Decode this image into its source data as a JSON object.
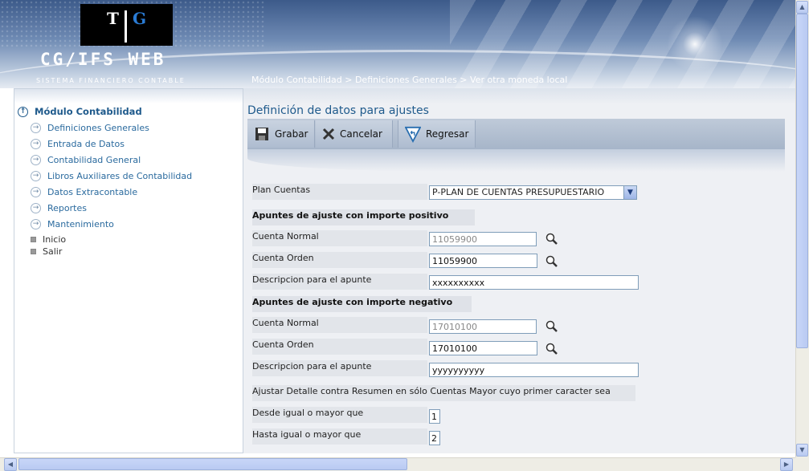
{
  "header": {
    "logo_left": "T",
    "logo_right": "G",
    "app_title": "CG/IFS WEB",
    "app_subtitle": "SISTEMA FINANCIERO CONTABLE",
    "breadcrumb": "Módulo Contabilidad > Definiciones Generales > Ver otra moneda local"
  },
  "sidebar": {
    "module": "Módulo Contabilidad",
    "items": [
      {
        "label": "Definiciones Generales"
      },
      {
        "label": "Entrada de Datos"
      },
      {
        "label": "Contabilidad General"
      },
      {
        "label": "Libros Auxiliares de Contabilidad"
      },
      {
        "label": "Datos Extracontable"
      },
      {
        "label": "Reportes"
      },
      {
        "label": "Mantenimiento"
      }
    ],
    "links": [
      {
        "label": "Inicio"
      },
      {
        "label": "Salir"
      }
    ]
  },
  "main": {
    "title": "Definición de datos para ajustes",
    "toolbar": {
      "save_label": "Grabar",
      "cancel_label": "Cancelar",
      "back_label": "Regresar"
    },
    "form": {
      "plan_label": "Plan Cuentas",
      "plan_value": "P-PLAN DE CUENTAS PRESUPUESTARIO",
      "positive_section": "Apuntes de ajuste con importe positivo",
      "pos_normal_label": "Cuenta Normal",
      "pos_normal_value": "11059900",
      "pos_orden_label": "Cuenta Orden",
      "pos_orden_value": "11059900",
      "pos_desc_label": "Descripcion para el apunte",
      "pos_desc_value": "xxxxxxxxxx",
      "negative_section": "Apuntes de ajuste con importe negativo",
      "neg_normal_label": "Cuenta Normal",
      "neg_normal_value": "17010100",
      "neg_orden_label": "Cuenta Orden",
      "neg_orden_value": "17010100",
      "neg_desc_label": "Descripcion para el apunte",
      "neg_desc_value": "yyyyyyyyyy",
      "adjust_note": "Ajustar Detalle contra Resumen en sólo Cuentas Mayor cuyo primer caracter sea",
      "desde_label": "Desde igual o mayor que",
      "desde_value": "1",
      "hasta_label": "Hasta igual o mayor que",
      "hasta_value": "2"
    }
  },
  "icons": {
    "save": "floppy-disk-icon",
    "cancel": "x-icon",
    "back": "return-arrow-icon",
    "lookup": "magnifier-icon"
  }
}
